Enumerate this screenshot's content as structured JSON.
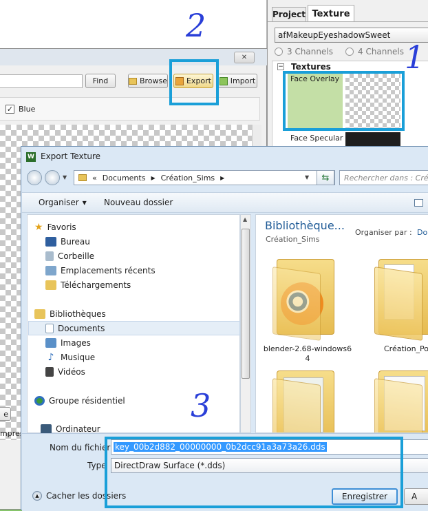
{
  "top_right": {
    "tabs": [
      "Project",
      "Texture"
    ],
    "dropdown_value": "afMakeupEyeshadowSweet",
    "channel_options": [
      "3 Channels",
      "4 Channels"
    ],
    "textures_header": "Textures",
    "items": [
      "Face Overlay",
      "Face Specular"
    ]
  },
  "tool_window": {
    "close_glyph": "✕",
    "find_label": "Find",
    "browse_label": "Browse",
    "export_label": "Export",
    "import_label": "Import",
    "blue_checkbox_label": "Blue",
    "partial_button_text": "e",
    "partial_text": "mpres"
  },
  "dialog": {
    "title": "Export Texture",
    "app_badge": "W",
    "breadcrumb": [
      "«",
      "Documents",
      "Création_Sims"
    ],
    "search_placeholder": "Rechercher dans : Créa",
    "toolbar": {
      "organize": "Organiser",
      "new_folder": "Nouveau dossier"
    },
    "nav": {
      "favorites": "Favoris",
      "favorites_items": [
        "Bureau",
        "Corbeille",
        "Emplacements récents",
        "Téléchargements"
      ],
      "libraries": "Bibliothèques",
      "library_items": [
        "Documents",
        "Images",
        "Musique",
        "Vidéos"
      ],
      "homegroup": "Groupe résidentiel",
      "computer": "Ordinateur"
    },
    "content": {
      "title": "Bibliothèque...",
      "subtitle": "Création_Sims",
      "arrange_label": "Organiser par :",
      "arrange_value": "Do",
      "files": [
        "blender-2.68-windows64",
        "Création_Po"
      ]
    },
    "filename_label": "Nom du fichier",
    "filename_value": "key_00b2d882_00000000_0b2dcc91a3a73a26.dds",
    "type_label": "Type",
    "type_value": "DirectDraw Surface (*.dds)",
    "hide_folders": "Cacher les dossiers",
    "save_button": "Enregistrer",
    "cancel_partial": "A"
  },
  "annotations": [
    "2",
    "1",
    "3"
  ],
  "colors": {
    "highlight": "#1a9fd8",
    "annotation": "#2a3fd8",
    "selection": "#3399ff",
    "green_bg": "#86c46a"
  }
}
